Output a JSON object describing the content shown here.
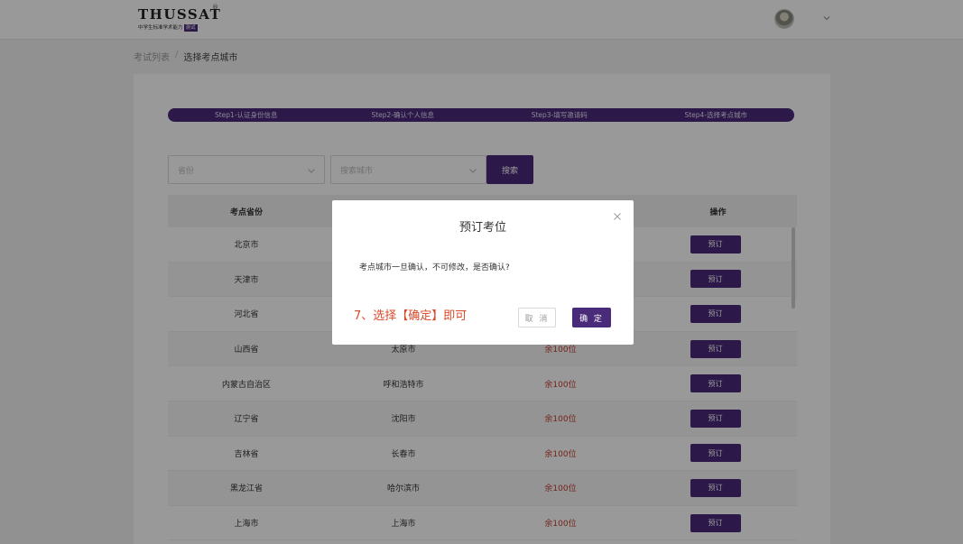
{
  "header": {
    "logo_title": "THUSSAT",
    "logo_reg": "®",
    "logo_sub": "中学生标准学术能力",
    "logo_badge": "测试",
    "avatar_icon": "user-avatar",
    "menu_icon": "chevron-down-icon"
  },
  "breadcrumb": {
    "parent": "考试列表",
    "separator": "/",
    "current": "选择考点城市"
  },
  "steps": [
    {
      "label": "Step1-认证身份信息"
    },
    {
      "label": "Step2-确认个人信息"
    },
    {
      "label": "Step3-填写邀请码"
    },
    {
      "label": "Step4-选择考点城市"
    }
  ],
  "filters": {
    "province_placeholder": "省份",
    "city_placeholder": "搜索城市",
    "search_label": "搜索"
  },
  "table": {
    "headers": [
      "考点省份",
      "",
      "",
      "操作"
    ],
    "rows": [
      {
        "province": "北京市",
        "city": "",
        "seats": "",
        "action": "预订"
      },
      {
        "province": "天津市",
        "city": "",
        "seats": "",
        "action": "预订"
      },
      {
        "province": "河北省",
        "city": "",
        "seats": "",
        "action": "预订"
      },
      {
        "province": "山西省",
        "city": "太原市",
        "seats": "余100位",
        "action": "预订"
      },
      {
        "province": "内蒙古自治区",
        "city": "呼和浩特市",
        "seats": "余100位",
        "action": "预订"
      },
      {
        "province": "辽宁省",
        "city": "沈阳市",
        "seats": "余100位",
        "action": "预订"
      },
      {
        "province": "吉林省",
        "city": "长春市",
        "seats": "余100位",
        "action": "预订"
      },
      {
        "province": "黑龙江省",
        "city": "哈尔滨市",
        "seats": "余100位",
        "action": "预订"
      },
      {
        "province": "上海市",
        "city": "上海市",
        "seats": "余100位",
        "action": "预订"
      }
    ]
  },
  "modal": {
    "title": "预订考位",
    "message": "考点城市一旦确认，不可修改，是否确认?",
    "annotation": "7、选择【确定】即可",
    "cancel_label": "取 消",
    "ok_label": "确 定"
  },
  "colors": {
    "brand": "#4a2b7a",
    "danger": "#c0392b",
    "annotation": "#d94a2b"
  }
}
